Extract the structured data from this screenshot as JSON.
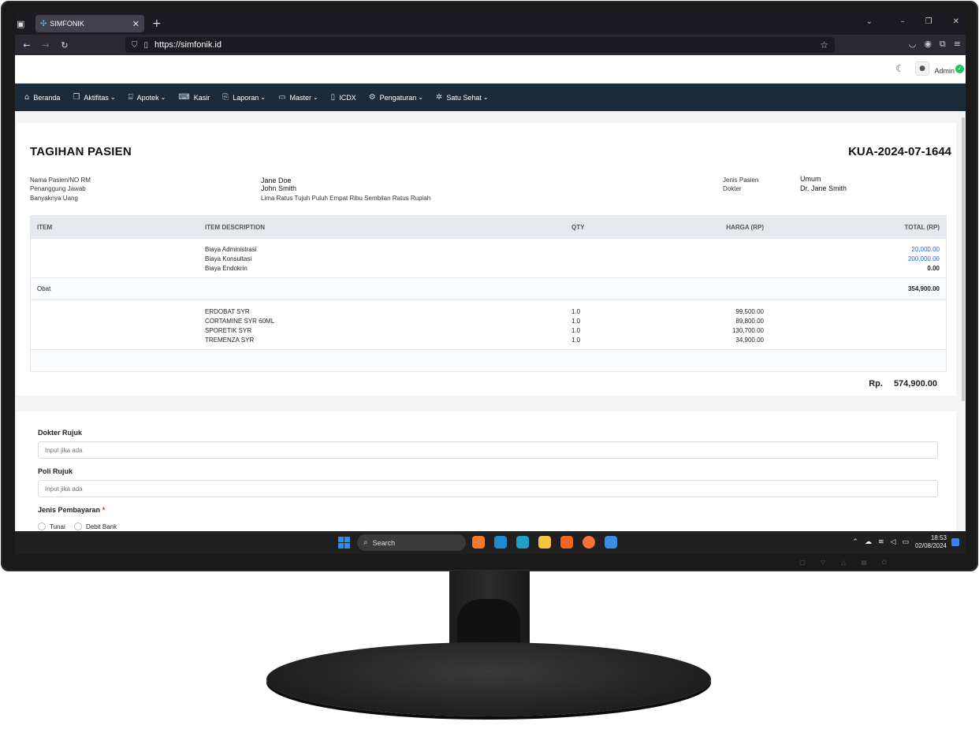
{
  "browser": {
    "tab_title": "SIMFONIK",
    "url": "https://simfonik.id"
  },
  "header": {
    "user_name": "Admin"
  },
  "menu": [
    {
      "label": "Beranda",
      "icon": "home-icon",
      "glyph": "⌂",
      "dropdown": false
    },
    {
      "label": "Aktifitas",
      "icon": "activity-icon",
      "glyph": "❐",
      "dropdown": true
    },
    {
      "label": "Apotek",
      "icon": "store-icon",
      "glyph": "⌸",
      "dropdown": true
    },
    {
      "label": "Kasir",
      "icon": "cash-register-icon",
      "glyph": "⌨",
      "dropdown": false
    },
    {
      "label": "Laporan",
      "icon": "report-icon",
      "glyph": "⎘",
      "dropdown": true
    },
    {
      "label": "Master",
      "icon": "database-icon",
      "glyph": "▭",
      "dropdown": true
    },
    {
      "label": "ICDX",
      "icon": "file-icon",
      "glyph": "▯",
      "dropdown": false
    },
    {
      "label": "Pengaturan",
      "icon": "gear-icon",
      "glyph": "⚙",
      "dropdown": true
    },
    {
      "label": "Satu Sehat",
      "icon": "cog-icon",
      "glyph": "✲",
      "dropdown": true
    }
  ],
  "invoice": {
    "title": "TAGIHAN PASIEN",
    "number": "KUA-2024-07-1644",
    "labels": {
      "patient": "Nama Pasien/NO RM",
      "guarantor": "Penanggung Jawab",
      "amount_words": "Banyaknya Uang",
      "patient_type": "Jenis Pasien",
      "doctor": "Dokter"
    },
    "values": {
      "patient": "Jane Doe",
      "guarantor": "John Smith",
      "amount_words": "Lima Ratus Tujuh Puluh Empat Ribu Sembilan Ratus Rupiah",
      "patient_type": "Umum",
      "doctor": "Dr. Jane Smith"
    },
    "columns": {
      "item": "ITEM",
      "desc": "ITEM DESCRIPTION",
      "qty": "QTY",
      "harga": "HARGA (RP)",
      "total": "TOTAL (RP)"
    },
    "fees": [
      {
        "desc": "Biaya Administrasi",
        "total": "20,000.00"
      },
      {
        "desc": "Biaya Konsultasi",
        "total": "200,000.00"
      },
      {
        "desc": "Biaya Endokrin",
        "total": "0.00"
      }
    ],
    "obat_label": "Obat",
    "obat_total": "354,900.00",
    "drugs": [
      {
        "desc": "ERDOBAT SYR",
        "qty": "1.0",
        "harga": "99,500.00"
      },
      {
        "desc": "CORTAMINE SYR 60ML",
        "qty": "1.0",
        "harga": "89,800.00"
      },
      {
        "desc": "SPORETIK SYR",
        "qty": "1.0",
        "harga": "130,700.00"
      },
      {
        "desc": "TREMENZA SYR",
        "qty": "1.0",
        "harga": "34,900.00"
      }
    ],
    "grand_prefix": "Rp.",
    "grand_total": "574,900.00"
  },
  "form": {
    "dokter_rujuk_label": "Dokter Rujuk",
    "dokter_rujuk_placeholder": "Input jika ada",
    "poli_rujuk_label": "Poli Rujuk",
    "poli_rujuk_placeholder": "Input jika ada",
    "payment_label": "Jenis Pembayaran",
    "required_mark": "*",
    "payment_options": [
      "Tunai",
      "Debit Bank"
    ]
  },
  "taskbar": {
    "search_label": "Search",
    "time": "18:53",
    "date": "02/08/2024",
    "apps": [
      {
        "name": "blender-icon",
        "color": "#f5792a"
      },
      {
        "name": "vscode-icon",
        "color": "#1f8ad2"
      },
      {
        "name": "edge-icon",
        "color": "#1fa0c8"
      },
      {
        "name": "file-explorer-icon",
        "color": "#f4c542"
      },
      {
        "name": "app-orange-icon",
        "color": "#f26522"
      },
      {
        "name": "firefox-icon",
        "color": "#ff7139"
      },
      {
        "name": "app-blue-icon",
        "color": "#3a8ee6"
      }
    ]
  }
}
